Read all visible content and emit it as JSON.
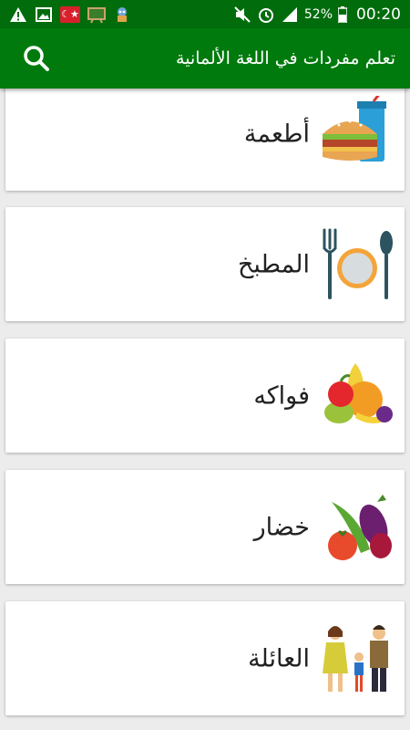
{
  "status_bar": {
    "battery": "52%",
    "time": "00:20",
    "colors": {
      "background": "#006c0c"
    }
  },
  "app_bar": {
    "title": "تعلم مفردات في اللغة الألمانية",
    "search_icon": "search-icon",
    "colors": {
      "background": "#007a0d"
    }
  },
  "categories": [
    {
      "label": "أطعمة",
      "icon": "burger-drink-icon"
    },
    {
      "label": "المطبخ",
      "icon": "plate-cutlery-icon"
    },
    {
      "label": "فواكه",
      "icon": "fruits-icon"
    },
    {
      "label": "خضار",
      "icon": "vegetables-icon"
    },
    {
      "label": "العائلة",
      "icon": "family-icon"
    }
  ]
}
